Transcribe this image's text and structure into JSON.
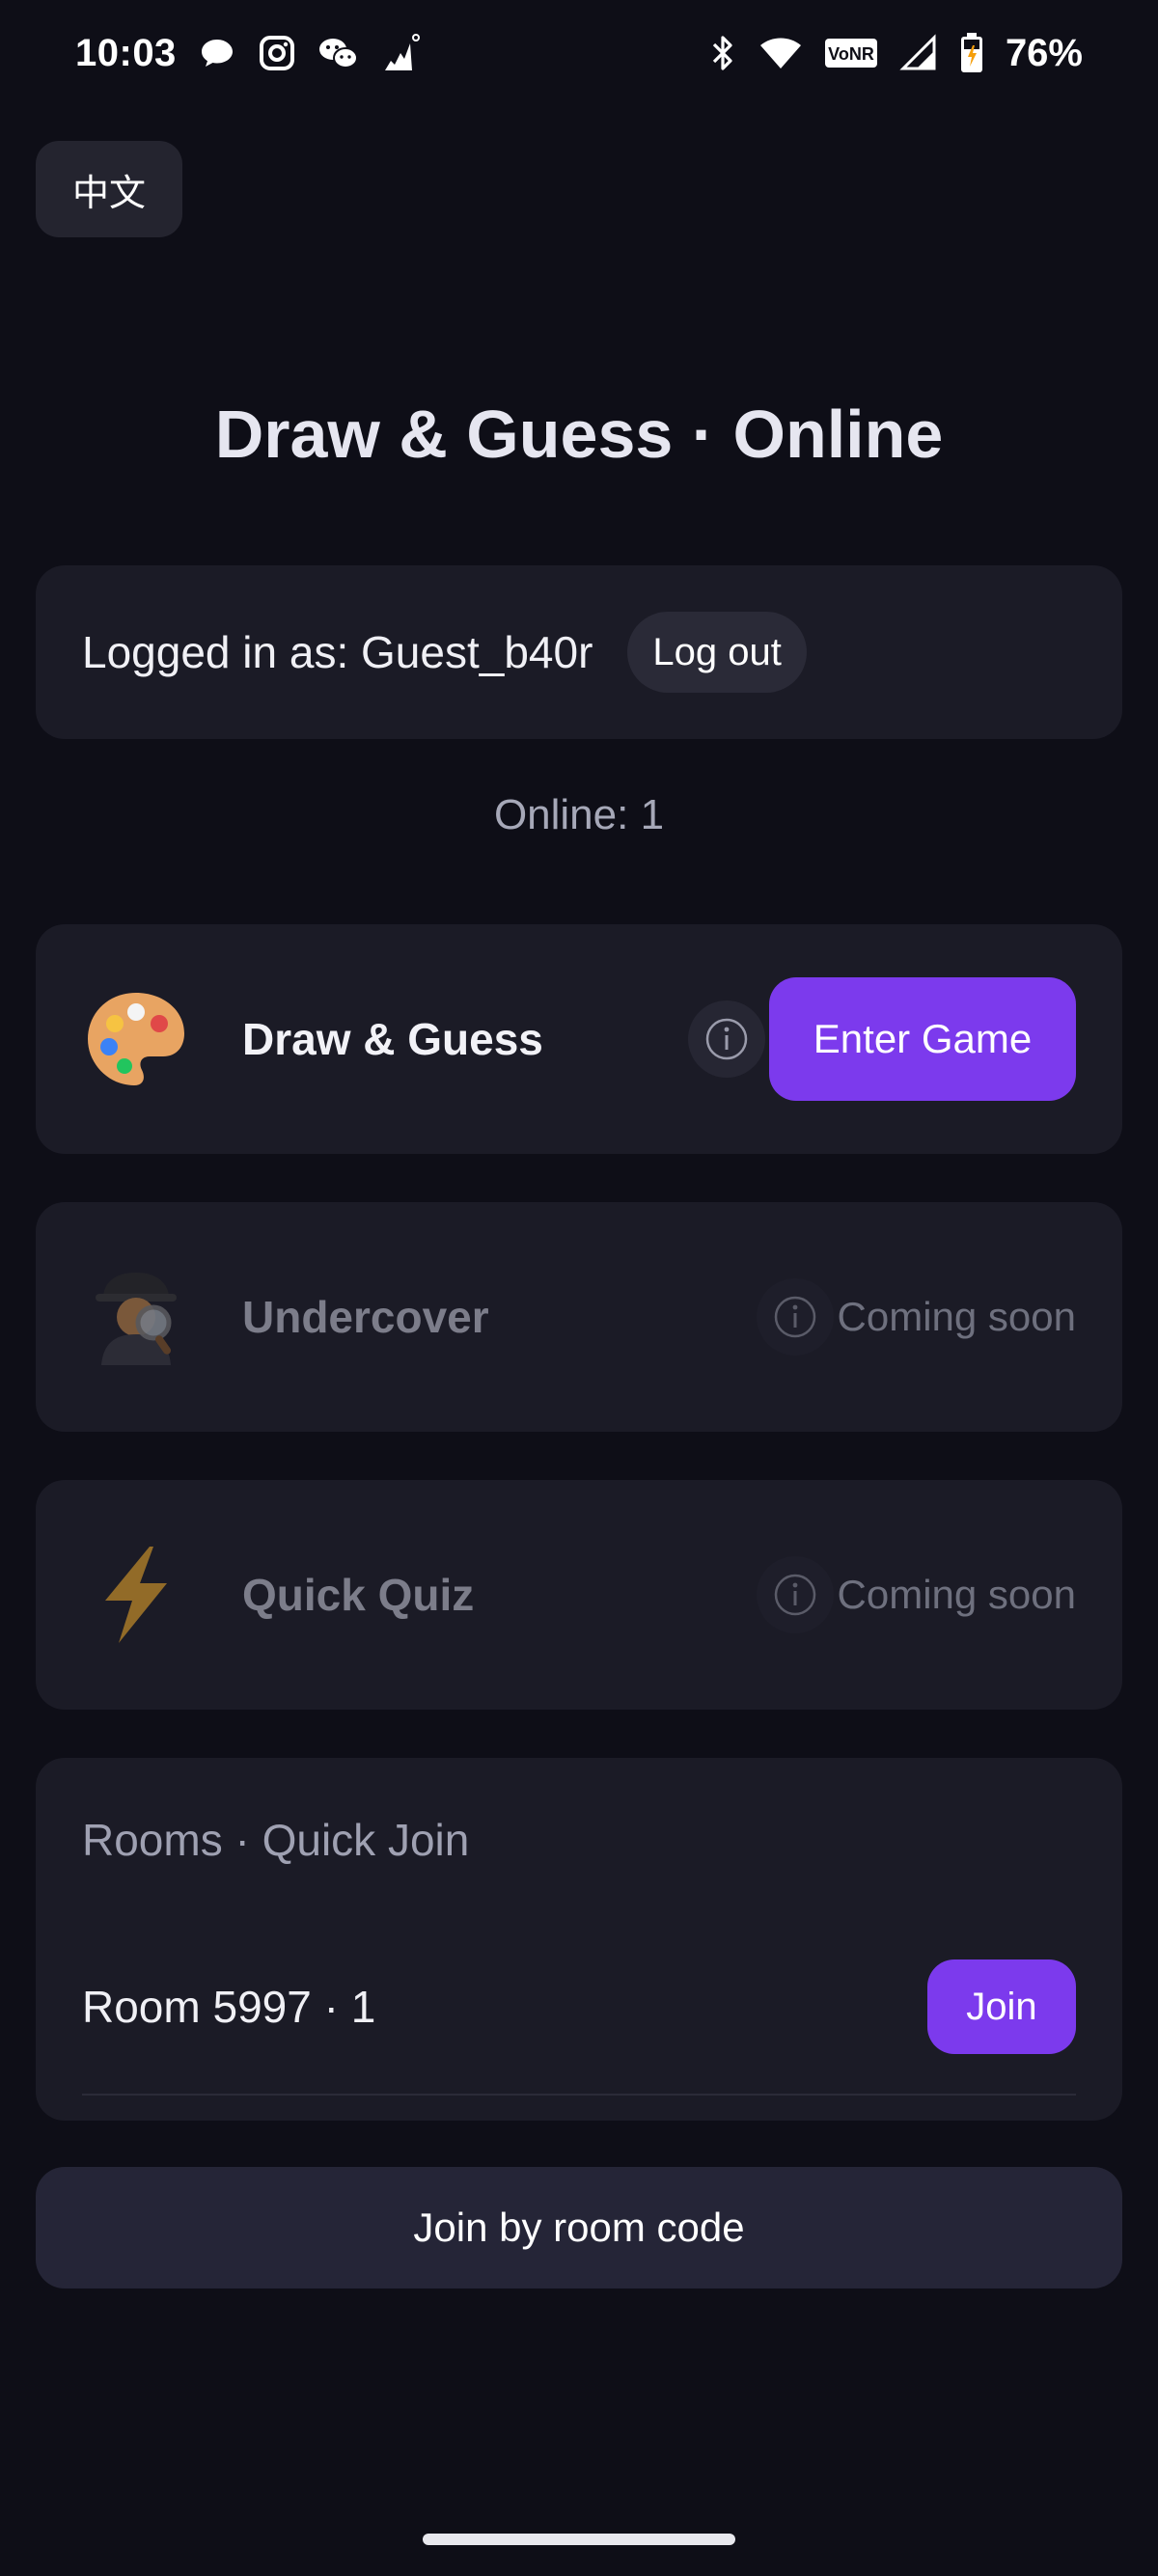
{
  "status_bar": {
    "time": "10:03",
    "battery_percent": "76%",
    "left_icons": [
      "chat-bubble-icon",
      "instagram-icon",
      "wechat-icon",
      "signal-app-icon"
    ],
    "right_icons": [
      "bluetooth-icon",
      "wifi-icon",
      "vonr-icon",
      "cell-signal-icon",
      "battery-charging-icon"
    ],
    "vonr_label": "VoNR"
  },
  "language_button": "中文",
  "title": "Draw & Guess · Online",
  "login": {
    "text": "Logged in as: Guest_b40r",
    "logout_label": "Log out"
  },
  "online_text": "Online: 1",
  "games": [
    {
      "icon": "artist-palette-icon",
      "emoji": "🎨",
      "name": "Draw & Guess",
      "enabled": true,
      "action_label": "Enter Game"
    },
    {
      "icon": "detective-icon",
      "emoji": "🕵️",
      "name": "Undercover",
      "enabled": false,
      "action_label": "Coming soon"
    },
    {
      "icon": "lightning-icon",
      "emoji": "⚡",
      "name": "Quick Quiz",
      "enabled": false,
      "action_label": "Coming soon"
    }
  ],
  "rooms": {
    "heading": "Rooms · Quick Join",
    "items": [
      {
        "label": "Room 5997 · 1",
        "join_label": "Join"
      }
    ]
  },
  "join_by_code_label": "Join by room code",
  "colors": {
    "accent": "#7c3aed",
    "background": "#0e0e17",
    "card": "#1b1b26"
  }
}
